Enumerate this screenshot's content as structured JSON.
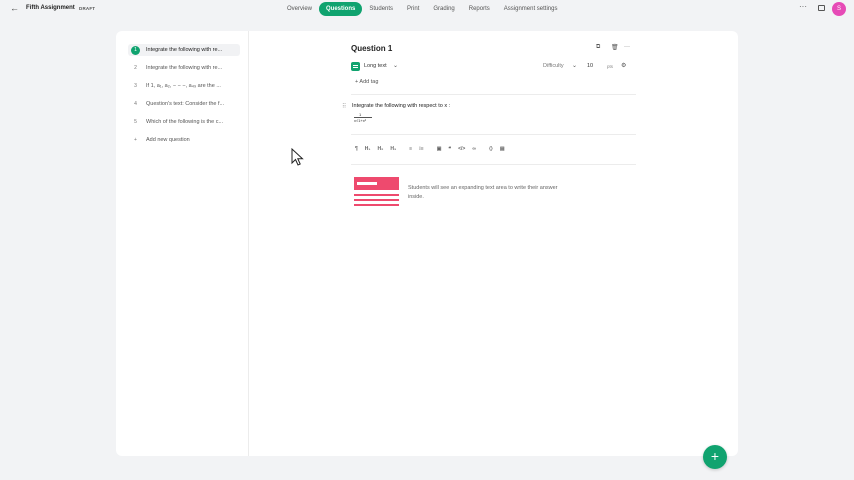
{
  "header": {
    "back_icon": "arrow-left-icon",
    "title": "Fifth Assignment",
    "badge": "DRAFT",
    "tabs": [
      {
        "label": "Overview",
        "active": false
      },
      {
        "label": "Questions",
        "active": true
      },
      {
        "label": "Students",
        "active": false
      },
      {
        "label": "Print",
        "active": false
      },
      {
        "label": "Grading",
        "active": false
      },
      {
        "label": "Reports",
        "active": false
      },
      {
        "label": "Assignment settings",
        "active": false
      }
    ],
    "more_glyph": "···",
    "avatar_initial": "S",
    "accent_color": "#10a36f",
    "avatar_color": "#e64ab6"
  },
  "sidebar": {
    "items": [
      {
        "number": "1",
        "label": "Integrate the following with re...",
        "active": true
      },
      {
        "number": "2",
        "label": "Integrate the following with re...",
        "active": false
      },
      {
        "number": "3",
        "label": "If 1, a₁, a₂, − − −, a₄₉ are the ...",
        "active": false
      },
      {
        "number": "4",
        "label": "Question's text: Consider the f...",
        "active": false
      },
      {
        "number": "5",
        "label": "Which of the following is the c...",
        "active": false
      }
    ],
    "add_label": "Add new question",
    "add_glyph": "+"
  },
  "editor": {
    "question_title": "Question 1",
    "type_label": "Long text",
    "type_chevron": "⌄",
    "difficulty_label": "Difficulty",
    "difficulty_chevron": "⌄",
    "points_value": "10",
    "points_label": "pts",
    "add_tag_label": "+ Add tag",
    "question_text": "Integrate the following with respect to x :",
    "formula_numerator": "1",
    "formula_denominator": "x√1+x²",
    "toolbar": [
      "¶",
      "H₁",
      "H₂",
      "H₃",
      "≡",
      "⁝≡",
      "▣",
      "❝",
      "</>",
      "∞",
      "⟨⟩",
      "▤"
    ],
    "preview_hint": "Students will see an expanding text area to write their answer inside.",
    "preview_color": "#ee4a6e"
  },
  "fab": {
    "glyph": "+"
  }
}
